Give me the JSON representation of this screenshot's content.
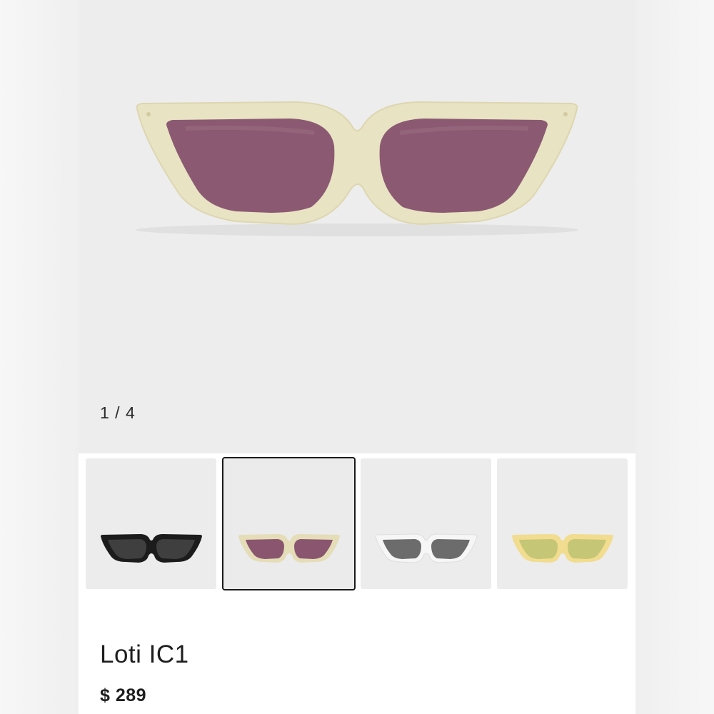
{
  "gallery": {
    "counter": "1 / 4",
    "main_image_icon": "sunglasses-cream-frame-purple-lens"
  },
  "thumbnails": [
    {
      "icon": "sunglasses-black",
      "frame": "#1c1c1c",
      "lens": "#3f3f3f",
      "selected": false
    },
    {
      "icon": "sunglasses-cream-purple",
      "frame": "#e4ddb8",
      "lens": "#8a566f",
      "selected": true
    },
    {
      "icon": "sunglasses-white-grey",
      "frame": "#f6f6f6",
      "lens": "#6c6c6c",
      "selected": false
    },
    {
      "icon": "sunglasses-yellow-green",
      "frame": "#f1dc8f",
      "lens": "#c5c676",
      "selected": false
    }
  ],
  "product": {
    "name": "Loti IC1",
    "price": "$ 289"
  },
  "colors": {
    "main_frame": "#e8e3c3",
    "main_lens": "#8b5a72",
    "selected_border": "#1a1a1a"
  }
}
